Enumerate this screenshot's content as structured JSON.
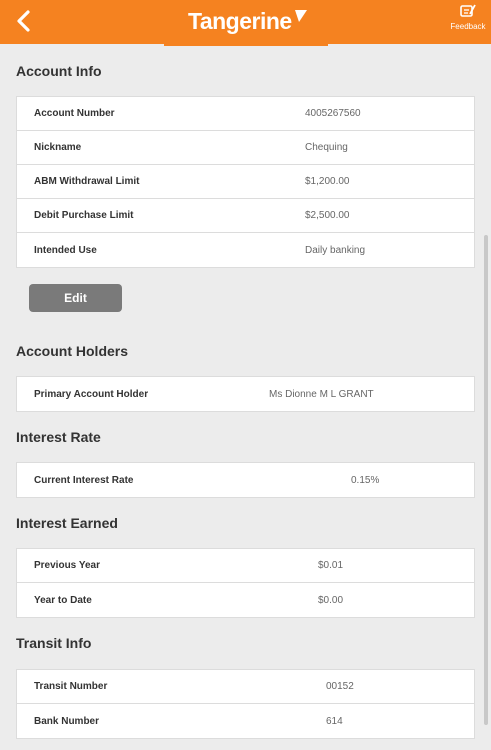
{
  "header": {
    "logo_text": "Tangerine",
    "feedback_label": "Feedback",
    "accent_color": "#f58220",
    "back_icon": "chevron-left-icon",
    "feedback_icon": "feedback-edit-icon"
  },
  "account_info": {
    "title": "Account Info",
    "rows": [
      {
        "label": "Account Number",
        "value": "4005267560"
      },
      {
        "label": "Nickname",
        "value": "Chequing"
      },
      {
        "label": "ABM Withdrawal Limit",
        "value": "$1,200.00"
      },
      {
        "label": "Debit Purchase Limit",
        "value": "$2,500.00"
      },
      {
        "label": "Intended Use",
        "value": "Daily banking"
      }
    ],
    "edit_label": "Edit"
  },
  "account_holders": {
    "title": "Account Holders",
    "rows": [
      {
        "label": "Primary Account Holder",
        "value": "Ms Dionne M L GRANT"
      }
    ]
  },
  "interest_rate": {
    "title": "Interest Rate",
    "rows": [
      {
        "label": "Current Interest Rate",
        "value": "0.15%"
      }
    ]
  },
  "interest_earned": {
    "title": "Interest Earned",
    "rows": [
      {
        "label": "Previous Year",
        "value": "$0.01"
      },
      {
        "label": "Year to Date",
        "value": "$0.00"
      }
    ]
  },
  "transit_info": {
    "title": "Transit Info",
    "rows": [
      {
        "label": "Transit Number",
        "value": "00152"
      },
      {
        "label": "Bank Number",
        "value": "614"
      }
    ]
  }
}
